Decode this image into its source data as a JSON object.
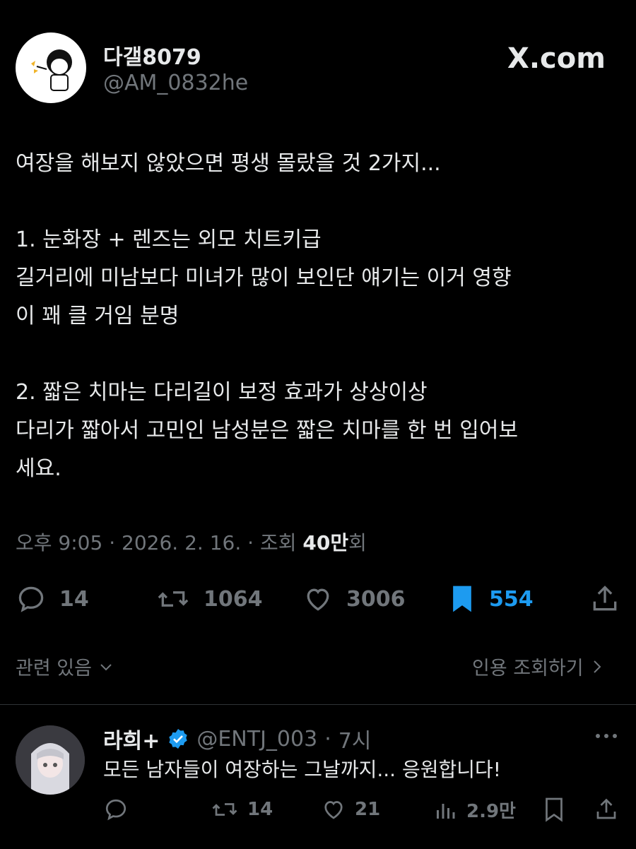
{
  "tweet": {
    "display_name": "다갤8079",
    "handle": "@AM_0832he",
    "brand": "X.com",
    "text": "여장을 해보지 않았으면 평생 몰랐을 것 2가지...\n\n1. 눈화장 + 렌즈는 외모 치트키급\n길거리에 미남보다 미녀가 많이 보인단 얘기는 이거 영향\n이 꽤 클 거임 분명\n\n2. 짧은 치마는 다리길이 보정 효과가 상상이상\n다리가 짧아서 고민인 남성분은 짧은 치마를 한 번 입어보\n세요.",
    "time": "오후 9:05",
    "date": "2026. 2. 16.",
    "views_prefix": "조회",
    "views_count": "40만",
    "views_suffix": "회",
    "replies": "14",
    "retweets": "1064",
    "likes": "3006",
    "bookmarks": "554",
    "related_label": "관련 있음",
    "quotes_label": "인용 조회하기"
  },
  "reply": {
    "display_name": "라희+",
    "handle": "@ENTJ_003",
    "time": "7시",
    "text": "모든 남자들이 여장하는 그날까지... 응원합니다!",
    "replies": "",
    "retweets": "14",
    "likes": "21",
    "views": "2.9만"
  },
  "colors": {
    "background": "#000000",
    "text": "#e7e9ea",
    "muted": "#71767b",
    "accent": "#1d9bf0"
  },
  "icons": [
    "reply-icon",
    "retweet-icon",
    "heart-icon",
    "bookmark-icon",
    "share-icon",
    "verified-icon",
    "more-icon",
    "chevron-down-icon",
    "chevron-right-icon",
    "views-icon"
  ]
}
